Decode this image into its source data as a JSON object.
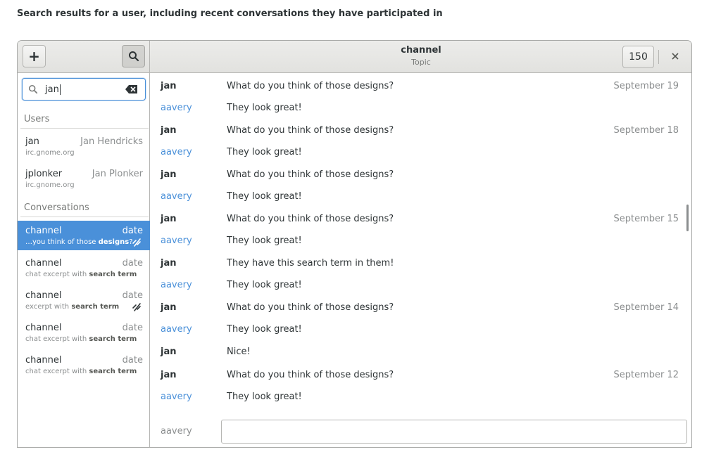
{
  "caption": "Search results for a user, including recent conversations they have participated in",
  "colors": {
    "accent": "#4a90d9",
    "nick_other": "#4a90d9",
    "selected_bg": "#4a90d9"
  },
  "header": {
    "add_icon": "plus-icon",
    "search_icon": "search-icon",
    "title": "channel",
    "subtitle": "Topic",
    "user_count": "150",
    "close_icon": "close-icon"
  },
  "sidebar": {
    "search": {
      "value": "jan",
      "icon": "search-icon",
      "clear_icon": "clear-text-icon"
    },
    "users_heading": "Users",
    "users": [
      {
        "nick": "jan",
        "real_name": "Jan Hendricks",
        "server": "irc.gnome.org"
      },
      {
        "nick": "jplonker",
        "real_name": "Jan Plonker",
        "server": "irc.gnome.org"
      }
    ],
    "conversations_heading": "Conversations",
    "conversations": [
      {
        "channel": "channel",
        "date": "date",
        "excerpt_pre": "…you think of those ",
        "excerpt_term": "designs",
        "excerpt_post": "?",
        "selected": true,
        "icon": "disconnected-icon"
      },
      {
        "channel": "channel",
        "date": "date",
        "excerpt_pre": "chat excerpt with ",
        "excerpt_term": "search term",
        "excerpt_post": "",
        "selected": false
      },
      {
        "channel": "channel",
        "date": "date",
        "excerpt_pre": "excerpt with ",
        "excerpt_term": "search term",
        "excerpt_post": "",
        "selected": false,
        "icon": "disconnected-icon"
      },
      {
        "channel": "channel",
        "date": "date",
        "excerpt_pre": "chat excerpt with ",
        "excerpt_term": "search term",
        "excerpt_post": "",
        "selected": false
      },
      {
        "channel": "channel",
        "date": "date",
        "excerpt_pre": "chat excerpt with ",
        "excerpt_term": "search term",
        "excerpt_post": "",
        "selected": false
      }
    ]
  },
  "chat": {
    "messages": [
      {
        "nick": "jan",
        "text": "What do you think of those designs?",
        "date": "September 19"
      },
      {
        "nick": "aavery",
        "text": "They look great!",
        "date": ""
      },
      {
        "nick": "jan",
        "text": "What do you think of those designs?",
        "date": "September 18"
      },
      {
        "nick": "aavery",
        "text": "They look great!",
        "date": ""
      },
      {
        "nick": "jan",
        "text": "What do you think of those designs?",
        "date": ""
      },
      {
        "nick": "aavery",
        "text": "They look great!",
        "date": ""
      },
      {
        "nick": "jan",
        "text": "What do you think of those designs?",
        "date": "September 15"
      },
      {
        "nick": "aavery",
        "text": "They look great!",
        "date": ""
      },
      {
        "nick": "jan",
        "text": "They have this search term in them!",
        "date": ""
      },
      {
        "nick": "aavery",
        "text": "They look great!",
        "date": ""
      },
      {
        "nick": "jan",
        "text": "What do you think of those designs?",
        "date": "September 14"
      },
      {
        "nick": "aavery",
        "text": "They look great!",
        "date": ""
      },
      {
        "nick": "jan",
        "text": "Nice!",
        "date": ""
      },
      {
        "nick": "jan",
        "text": "What do you think of those designs?",
        "date": "September 12"
      },
      {
        "nick": "aavery",
        "text": "They look great!",
        "date": ""
      }
    ],
    "compose": {
      "nick": "aavery",
      "value": ""
    }
  }
}
